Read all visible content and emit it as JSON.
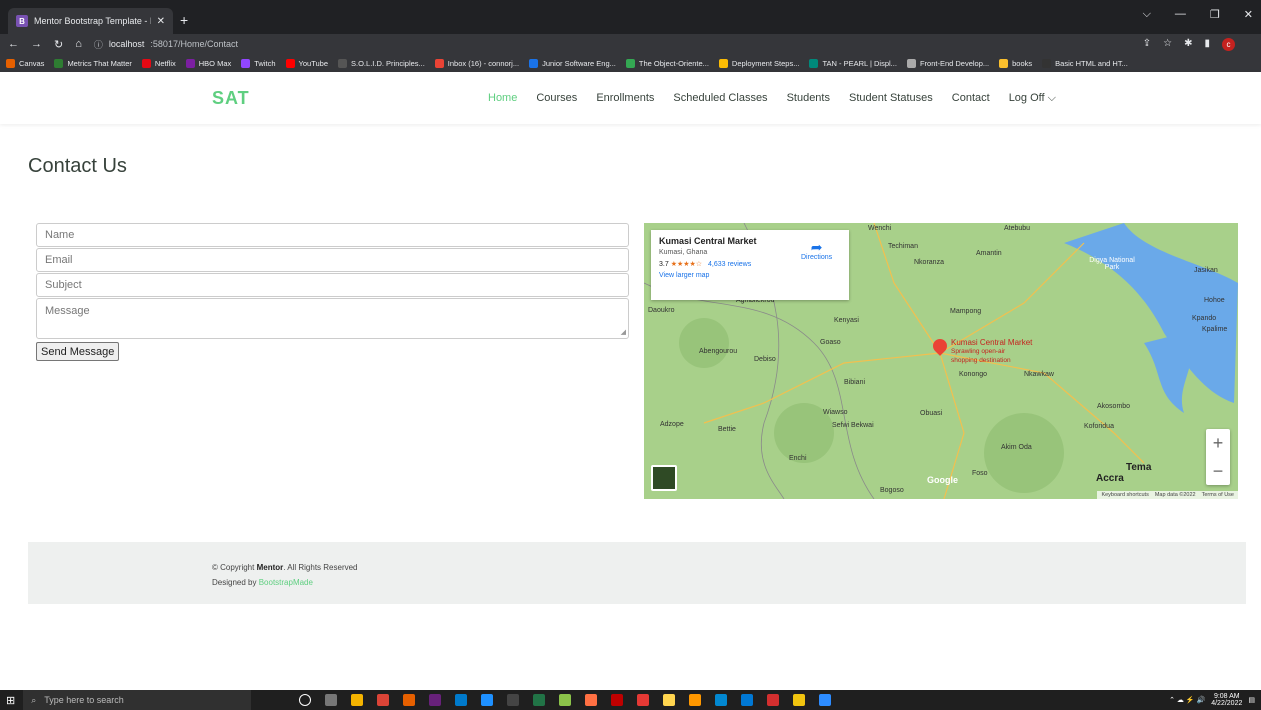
{
  "browser": {
    "tab_title": "Mentor Bootstrap Template - Ind",
    "favicon_letter": "B",
    "url_host": "localhost",
    "url_rest": ":58017/Home/Contact",
    "profile_letter": "c",
    "bookmarks": [
      {
        "label": "Canvas",
        "color": "#e66000"
      },
      {
        "label": "Metrics That Matter",
        "color": "#2e7d32"
      },
      {
        "label": "Netflix",
        "color": "#e50914"
      },
      {
        "label": "HBO Max",
        "color": "#7b1fa2"
      },
      {
        "label": "Twitch",
        "color": "#9146ff"
      },
      {
        "label": "YouTube",
        "color": "#ff0000"
      },
      {
        "label": "S.O.L.I.D. Principles...",
        "color": "#555555"
      },
      {
        "label": "Inbox (16) - connorj...",
        "color": "#ea4335"
      },
      {
        "label": "Junior Software Eng...",
        "color": "#1a73e8"
      },
      {
        "label": "The Object-Oriente...",
        "color": "#34a853"
      },
      {
        "label": "Deployment Steps...",
        "color": "#fbbc04"
      },
      {
        "label": "TAN - PEARL | Displ...",
        "color": "#00897b"
      },
      {
        "label": "Front-End Develop...",
        "color": "#aaaaaa"
      },
      {
        "label": "books",
        "color": "#fbc02d"
      },
      {
        "label": "Basic HTML and HT...",
        "color": "#333333"
      }
    ]
  },
  "site": {
    "logo": "SAT",
    "nav": [
      "Home",
      "Courses",
      "Enrollments",
      "Scheduled Classes",
      "Students",
      "Student Statuses",
      "Contact",
      "Log Off ⌵"
    ]
  },
  "contact": {
    "title": "Contact Us",
    "name_placeholder": "Name",
    "email_placeholder": "Email",
    "subject_placeholder": "Subject",
    "message_placeholder": "Message",
    "send_label": "Send Message"
  },
  "map": {
    "place_name": "Kumasi Central Market",
    "place_address": "Kumasi, Ghana",
    "rating": "3.7",
    "stars": "★★★★☆",
    "reviews": "4,633 reviews",
    "larger_map": "View larger map",
    "directions": "Directions",
    "marker_label": "Kumasi Central Market",
    "marker_sub1": "Sprawling open-air",
    "marker_sub2": "shopping destination",
    "cities": [
      "Wenchi",
      "Atebubu",
      "Techiman",
      "Amantin",
      "Nkoranza",
      "Digya National Park",
      "Jasikan",
      "Hohoe",
      "Kpando",
      "Kpalime",
      "Mampong",
      "Kenyasi",
      "Goaso",
      "Abengourou",
      "Debiso",
      "Bibiani",
      "Konongo",
      "Nkawkaw",
      "Akosombo",
      "Koforidua",
      "Wiawso",
      "Sefwi Bekwai",
      "Obuasi",
      "Adzope",
      "Bettie",
      "Akim Oda",
      "Enchi",
      "Foso",
      "Tema",
      "Accra",
      "Bogoso",
      "Agnibilekrou",
      "Daoukro"
    ],
    "attribution": [
      "Keyboard shortcuts",
      "Map data ©2022",
      "Terms of Use"
    ],
    "google": "Google"
  },
  "footer": {
    "copyright_prefix": "© Copyright ",
    "brand": "Mentor",
    "copyright_suffix": ". All Rights Reserved",
    "designed_prefix": "Designed by ",
    "designer": "BootstrapMade"
  },
  "taskbar": {
    "search_placeholder": "Type here to search",
    "time": "9:08 AM",
    "date": "4/22/2022"
  }
}
